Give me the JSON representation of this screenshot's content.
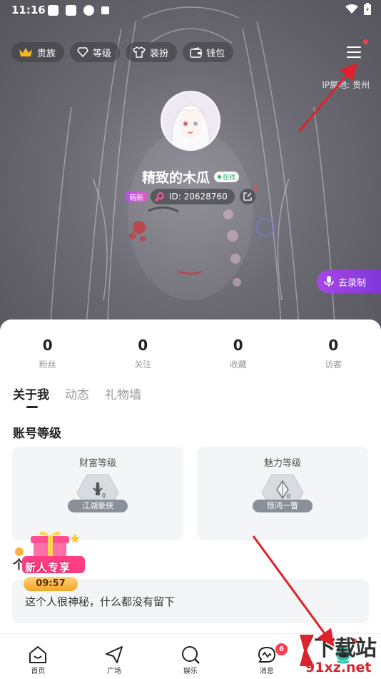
{
  "status_bar": {
    "time": "11:16"
  },
  "header": {
    "pills": [
      {
        "icon": "crown-icon",
        "label": "贵族"
      },
      {
        "icon": "diamond-icon",
        "label": "等级"
      },
      {
        "icon": "shirt-icon",
        "label": "装扮"
      },
      {
        "icon": "wallet-icon",
        "label": "钱包"
      }
    ],
    "ip_location": "IP属地: 贵州"
  },
  "profile": {
    "username": "精致的木瓜",
    "online_label": "在线",
    "new_badge": "萌新",
    "id_text": "ID: 20628760",
    "record_button": "去录制"
  },
  "stats": [
    {
      "value": "0",
      "label": "粉丝"
    },
    {
      "value": "0",
      "label": "关注"
    },
    {
      "value": "0",
      "label": "收藏"
    },
    {
      "value": "0",
      "label": "访客"
    }
  ],
  "tabs": [
    "关于我",
    "动态",
    "礼物墙"
  ],
  "account_level": {
    "title": "账号等级",
    "wealth": {
      "title": "财富等级",
      "rank": "江湖豪侠",
      "level": "0"
    },
    "charm": {
      "title": "魅力等级",
      "rank": "惊鸿一瞥",
      "level": "0"
    }
  },
  "about": {
    "title": "个人",
    "bio": "这个人很神秘，什么都没有留下"
  },
  "promo": {
    "label": "新人专享",
    "timer": "09:57"
  },
  "bottom_nav": [
    {
      "icon": "home-icon",
      "label": "首页"
    },
    {
      "icon": "plaza-icon",
      "label": "广场"
    },
    {
      "icon": "entertainment-icon",
      "label": "娱乐"
    },
    {
      "icon": "message-icon",
      "label": "消息"
    },
    {
      "icon": "me-icon",
      "label": ""
    }
  ],
  "message_badge": "6",
  "watermark": {
    "text": "下载站",
    "url": "91xz.net"
  },
  "colors": {
    "accent_purple": "#a846e8",
    "online_green": "#2bb673",
    "badge_red": "#ff3b4e",
    "arrow_red": "#e0202a"
  }
}
